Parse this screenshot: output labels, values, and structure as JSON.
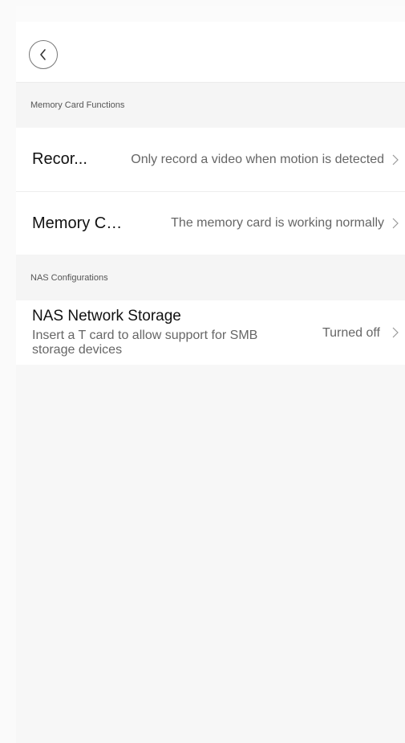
{
  "header": {
    "back_icon": "chevron-left-icon"
  },
  "memory_section": {
    "label": "Memory Card Functions",
    "rows": [
      {
        "title": "Recor...",
        "value": "Only record a video when motion is detected"
      },
      {
        "title": "Memory Ca...",
        "value": "The memory card is working normally"
      }
    ]
  },
  "nas_section": {
    "label": "NAS Configurations",
    "row": {
      "title": "NAS Network Storage",
      "description": "Insert a T card to allow support for SMB storage devices",
      "value": "Turned off"
    }
  },
  "colors": {
    "background": "#f7f7f7",
    "row_background": "#ffffff",
    "secondary_text": "#666666"
  }
}
